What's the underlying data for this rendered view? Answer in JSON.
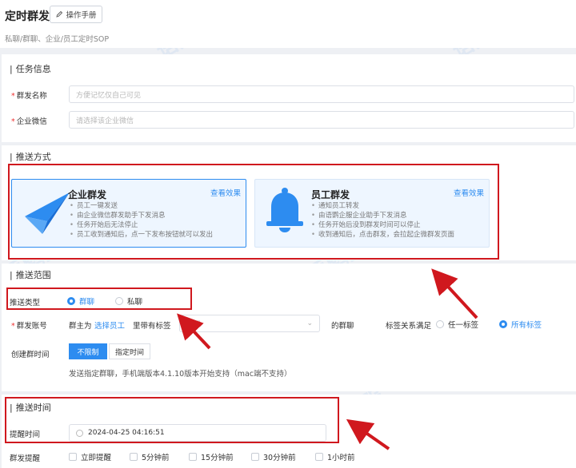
{
  "header": {
    "title": "定时群发",
    "manual_button": "操作手册",
    "subtitle": "私聊/群聊、企业/员工定时SOP"
  },
  "task_info": {
    "section_title": "任务信息",
    "name_label": "群发名称",
    "name_placeholder": "方便记忆仅自己可见",
    "wecom_label": "企业微信",
    "wecom_placeholder": "请选择该企业微信"
  },
  "push_method": {
    "section_title": "推送方式",
    "options": [
      {
        "name": "企业群发",
        "view": "查看效果",
        "icon": "paper-plane-icon",
        "selected": true,
        "bullets": [
          "员工一键发送",
          "由企业微信群发助手下发消息",
          "任务开始后无法停止",
          "员工收到通知后，点一下发布按钮就可以发出"
        ]
      },
      {
        "name": "员工群发",
        "view": "查看效果",
        "icon": "bell-icon",
        "selected": false,
        "bullets": [
          "通知员工转发",
          "由语鹦企服企业助手下发消息",
          "任务开始后没到群发时间可以停止",
          "收到通知后，点击群发，会拉起企微群发页面"
        ]
      }
    ]
  },
  "push_range": {
    "section_title": "推送范围",
    "type_label": "推送类型",
    "type_options": [
      "群聊",
      "私聊"
    ],
    "type_selected": "群聊",
    "account_label": "群发账号",
    "owner_prefix": "群主为",
    "select_staff": "选择员工",
    "tag_middle": "里带有标签",
    "tag_placeholder": "选择",
    "group_suffix": "的群聊",
    "tag_relation_label": "标签关系满足",
    "tag_relation_options": [
      "任一标签",
      "所有标签"
    ],
    "tag_relation_selected": "所有标签",
    "create_time_label": "创建群时间",
    "create_time_options": [
      "不限制",
      "指定时间"
    ],
    "create_time_selected": "不限制",
    "note": "发送指定群聊，手机端版本4.1.10版本开始支持（mac端不支持）"
  },
  "push_time": {
    "section_title": "推送时间",
    "remind_label": "提醒时间",
    "remind_value": "2024-04-25 04:16:51",
    "pre_remind_label": "群发提醒",
    "pre_remind_options": [
      "立即提醒",
      "5分钟前",
      "15分钟前",
      "30分钟前",
      "1小时前"
    ]
  },
  "watermark": "语鹦企服",
  "colors": {
    "accent": "#2d8cf0",
    "annotation_red": "#d0181e",
    "required": "#e33333"
  }
}
